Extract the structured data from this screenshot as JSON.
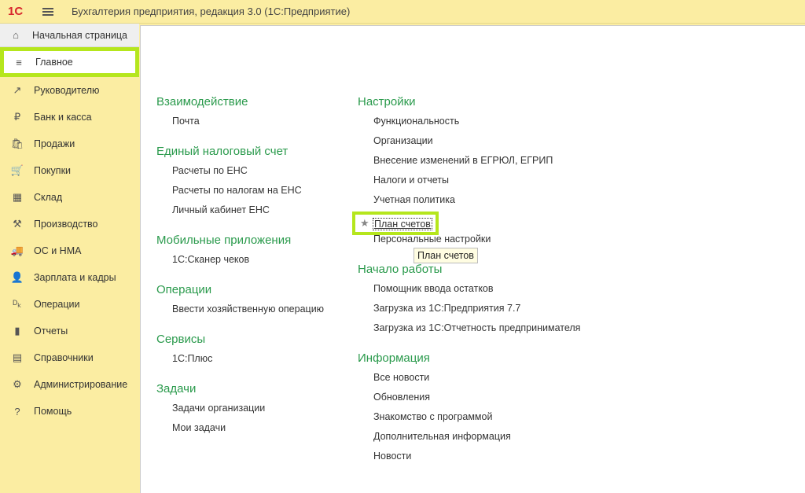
{
  "app": {
    "logo": "1С",
    "title": "Бухгалтерия предприятия, редакция 3.0  (1С:Предприятие)"
  },
  "sidebar": {
    "home": "Начальная страница",
    "selected": "Главное",
    "items": [
      {
        "label": "Руководителю",
        "icon": "chart-icon",
        "glyph": "↗"
      },
      {
        "label": "Банк и касса",
        "icon": "ruble-icon",
        "glyph": "₽"
      },
      {
        "label": "Продажи",
        "icon": "bag-icon",
        "glyph": "🛍"
      },
      {
        "label": "Покупки",
        "icon": "cart-icon",
        "glyph": "🛒"
      },
      {
        "label": "Склад",
        "icon": "warehouse-icon",
        "glyph": "▦"
      },
      {
        "label": "Производство",
        "icon": "factory-icon",
        "glyph": "⚒"
      },
      {
        "label": "ОС и НМА",
        "icon": "truck-icon",
        "glyph": "🚚"
      },
      {
        "label": "Зарплата и кадры",
        "icon": "person-icon",
        "glyph": "👤"
      },
      {
        "label": "Операции",
        "icon": "debit-credit-icon",
        "glyph": "ᴰₖ"
      },
      {
        "label": "Отчеты",
        "icon": "bar-chart-icon",
        "glyph": "▮"
      },
      {
        "label": "Справочники",
        "icon": "books-icon",
        "glyph": "▤"
      },
      {
        "label": "Администрирование",
        "icon": "gear-icon",
        "glyph": "⚙"
      },
      {
        "label": "Помощь",
        "icon": "help-icon",
        "glyph": "?"
      }
    ]
  },
  "left": [
    {
      "title": "Взаимодействие",
      "links": [
        "Почта"
      ]
    },
    {
      "title": "Единый налоговый счет",
      "links": [
        "Расчеты по ЕНС",
        "Расчеты по налогам на ЕНС",
        "Личный кабинет ЕНС"
      ]
    },
    {
      "title": "Мобильные приложения",
      "links": [
        "1С:Сканер чеков"
      ]
    },
    {
      "title": "Операции",
      "links": [
        "Ввести хозяйственную операцию"
      ]
    },
    {
      "title": "Сервисы",
      "links": [
        "1С:Плюс"
      ]
    },
    {
      "title": "Задачи",
      "links": [
        "Задачи организации",
        "Мои задачи"
      ]
    }
  ],
  "right": [
    {
      "title": "Настройки",
      "links": [
        "Функциональность",
        "Организации",
        "Внесение изменений в ЕГРЮЛ, ЕГРИП",
        "Налоги и отчеты",
        "Учетная политика",
        "",
        "Персональные настройки"
      ]
    },
    {
      "title": "Начало работы",
      "links": [
        "Помощник ввода остатков",
        "Загрузка из 1С:Предприятия 7.7",
        "Загрузка из 1С:Отчетность предпринимателя"
      ]
    },
    {
      "title": "Информация",
      "links": [
        "Все новости",
        "Обновления",
        "Знакомство с программой",
        "Дополнительная информация",
        "Новости"
      ]
    }
  ],
  "focused": {
    "label": "План счетов",
    "tooltip": "План счетов"
  },
  "colors": {
    "accent": "#2a9a4c",
    "highlight": "#b5e61d",
    "panel": "#fbeda2"
  }
}
